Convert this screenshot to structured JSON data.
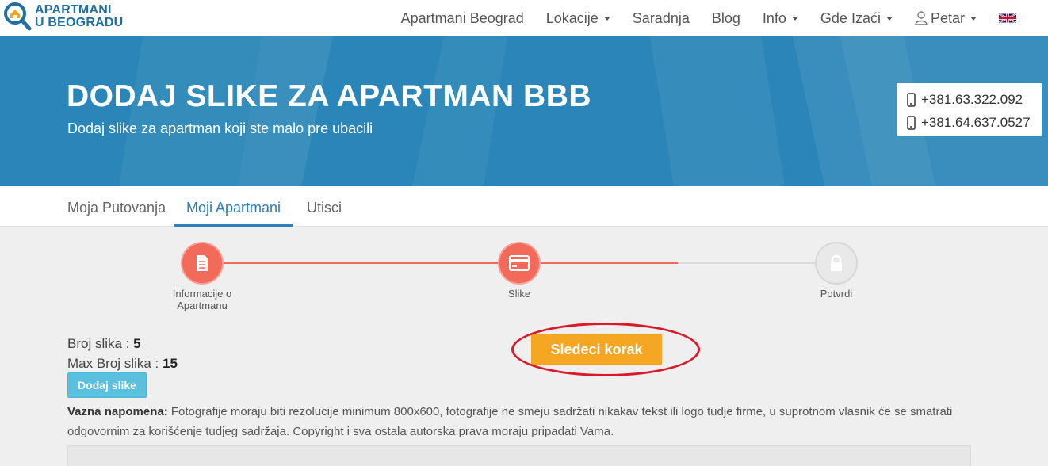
{
  "logo": {
    "line1": "APARTMANI",
    "line2": "U BEOGRADU"
  },
  "nav": {
    "items": [
      {
        "label": "Apartmani Beograd",
        "dropdown": false
      },
      {
        "label": "Lokacije",
        "dropdown": true
      },
      {
        "label": "Saradnja",
        "dropdown": false
      },
      {
        "label": "Blog",
        "dropdown": false
      },
      {
        "label": "Info",
        "dropdown": true
      },
      {
        "label": "Gde Izaći",
        "dropdown": true
      }
    ],
    "user": "Petar",
    "language_icon": "uk-flag-icon"
  },
  "hero": {
    "title": "DODAJ SLIKE ZA APARTMAN BBB",
    "subtitle": "Dodaj slike za apartman koji ste malo pre ubacili",
    "phones": [
      "+381.63.322.092",
      "+381.64.637.0527"
    ]
  },
  "tabs": [
    {
      "label": "Moja Putovanja",
      "active": false
    },
    {
      "label": "Moji Apartmani",
      "active": true
    },
    {
      "label": "Utisci",
      "active": false
    }
  ],
  "steps": [
    {
      "label": "Informacije o Apartmanu",
      "icon": "document-icon",
      "done": true
    },
    {
      "label": "Slike",
      "icon": "card-icon",
      "done": true
    },
    {
      "label": "Potvrdi",
      "icon": "lock-icon",
      "done": false
    }
  ],
  "images": {
    "count_label": "Broj slika : ",
    "count_value": "5",
    "max_label": "Max Broj slika : ",
    "max_value": "15",
    "add_button": "Dodaj slike",
    "next_button": "Sledeci korak"
  },
  "note": {
    "label": "Vazna napomena:",
    "text": " Fotografije moraju biti rezolucije minimum 800x600, fotografije ne smeju sadržati nikakav tekst ili logo tudje firme, u suprotnom vlasnik će se smatrati odgovornim za korišćenje tudjeg sadržaja. Copyright i sva ostala autorska prava moraju pripadati Vama."
  },
  "colors": {
    "primary": "#2a86b8",
    "accent_orange": "#f5a623",
    "step_done": "#f26a5a",
    "info_button": "#5bc0de",
    "highlight": "#d81b2a"
  }
}
